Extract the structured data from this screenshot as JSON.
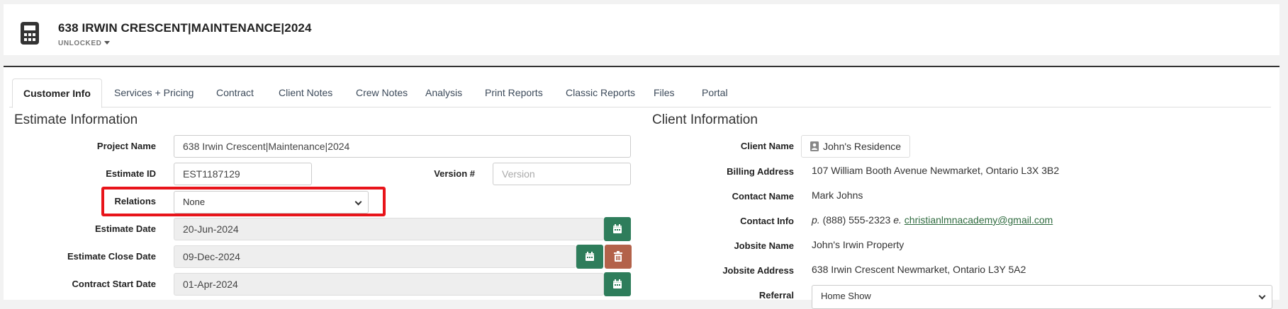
{
  "header": {
    "title": "638 IRWIN CRESCENT|MAINTENANCE|2024",
    "lock_status": "UNLOCKED",
    "icon": "calculator-icon"
  },
  "tabs": [
    {
      "label": "Customer Info",
      "active": true
    },
    {
      "label": "Services + Pricing",
      "active": false
    },
    {
      "label": "Contract",
      "active": false
    },
    {
      "label": "Client Notes",
      "active": false
    },
    {
      "label": "Crew Notes",
      "active": false
    },
    {
      "label": "Analysis",
      "active": false
    },
    {
      "label": "Print Reports",
      "active": false
    },
    {
      "label": "Classic Reports",
      "active": false
    },
    {
      "label": "Files",
      "active": false
    },
    {
      "label": "Portal",
      "active": false
    }
  ],
  "estimate": {
    "heading": "Estimate Information",
    "project_name_label": "Project Name",
    "project_name": "638 Irwin Crescent|Maintenance|2024",
    "estimate_id_label": "Estimate ID",
    "estimate_id": "EST1187129",
    "version_label": "Version #",
    "version_placeholder": "Version",
    "relations_label": "Relations",
    "relations_value": "None",
    "estimate_date_label": "Estimate Date",
    "estimate_date": "20-Jun-2024",
    "close_date_label": "Estimate Close Date",
    "close_date": "09-Dec-2024",
    "contract_start_label": "Contract Start Date",
    "contract_start": "01-Apr-2024"
  },
  "client": {
    "heading": "Client Information",
    "client_name_label": "Client Name",
    "client_name": "John's Residence",
    "billing_address_label": "Billing Address",
    "billing_address": "107 William Booth Avenue Newmarket, Ontario L3X 3B2",
    "contact_name_label": "Contact Name",
    "contact_name": "Mark Johns",
    "contact_info_label": "Contact Info",
    "phone_prefix": "p.",
    "phone": "(888) 555-2323",
    "email_prefix": "e.",
    "email": "christianlmnacademy@gmail.com",
    "jobsite_name_label": "Jobsite Name",
    "jobsite_name": "John's Irwin Property",
    "jobsite_address_label": "Jobsite Address",
    "jobsite_address": "638 Irwin Crescent Newmarket, Ontario L3Y 5A2",
    "referral_label": "Referral",
    "referral": "Home Show"
  },
  "colors": {
    "accent_green": "#2e7d5b",
    "danger": "#b3624a",
    "highlight": "#e8141a"
  }
}
